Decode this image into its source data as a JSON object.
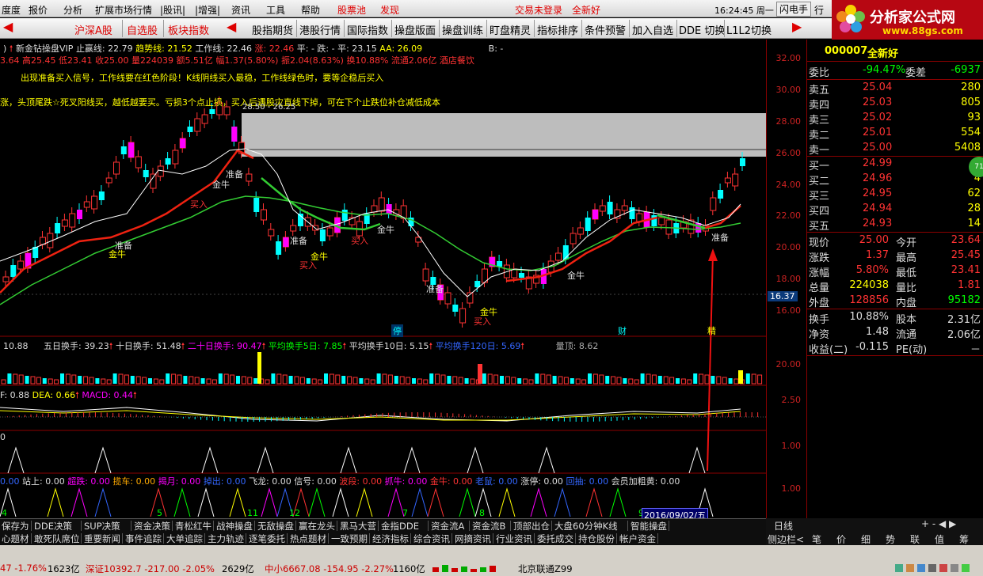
{
  "menubar": {
    "items": [
      "度度",
      "报价",
      "分析",
      "扩展市场行情",
      "|股讯|",
      "|增强|",
      "资讯",
      "工具",
      "帮助",
      "股票池",
      "发现"
    ],
    "login_status": "交易未登录",
    "stock_name": "全新好",
    "time": "16:24:45 周一",
    "flash_btn": "闪电手",
    "row_btn": "行"
  },
  "toolbar": {
    "items": [
      "沪深A股",
      "自选股",
      "板块指数",
      "股指期货",
      "港股行情",
      "国际指数",
      "操盘版面",
      "操盘训练",
      "盯盘精灵",
      "指标排序",
      "条件预警",
      "加入自选",
      "DDE 切换",
      "L1L2切换"
    ]
  },
  "logo": {
    "title": "分析家公式网",
    "url": "www.88gs.com"
  },
  "main_chart": {
    "title": "新金钻操盘VIP",
    "header_values": [
      "止赢线: 22.79",
      "趋势线: 21.52",
      "工作线: 22.46",
      "涨: 22.46",
      "平: -",
      "跌: -",
      "平: 23.15",
      "AA: 26.09",
      "B: -"
    ],
    "info_line": "3.64 高25.45 低23.41 收25.00 量224039 额5.51亿 幅1.37(5.80%) 振2.04(8.63%) 换10.88% 流通2.06亿 酒店餐饮",
    "note1": "出现准备买入信号，工作线要在红色阶段！K线阴线买入最稳，工作线绿色时，要等企稳后买入",
    "note2": "涨，头顶尾跌☆死叉阳线买，越低越要买。亏损3个点止损，买入后遇股灾直线下掉，可在下个止跌位补仓减低成本",
    "overlay_label": "28.50 - 26.25",
    "yaxis": [
      "32.00",
      "30.00",
      "28.00",
      "26.00",
      "24.00",
      "22.00",
      "20.00",
      "18.00",
      "16.00"
    ],
    "price_tag": "16.37",
    "signals": [
      "准备",
      "金牛",
      "买入",
      "准备",
      "金牛",
      "买入",
      "金牛",
      "买入",
      "准备",
      "金牛",
      "准备",
      "金牛",
      "买入",
      "金牛",
      "准备"
    ],
    "markers": [
      "停",
      "财",
      "精"
    ]
  },
  "turnover": {
    "labels": [
      "10.88",
      "五日换手: 39.23",
      "十日换手: 51.48",
      "二十日换手: 90.47",
      "平均换手5日: 7.85",
      "平均换手10日: 5.15",
      "平均换手120日: 5.69",
      "量顶: 8.62"
    ],
    "yaxis": [
      "20.00"
    ]
  },
  "macd": {
    "labels": [
      "F: 0.88",
      "DEA: 0.66",
      "MACD: 0.44"
    ],
    "yaxis": [
      "2.50"
    ]
  },
  "ind3": {
    "labels": [
      "0"
    ],
    "yaxis": [
      "1.00"
    ]
  },
  "ind4": {
    "labels": [
      "0.00",
      "站上: 0.00",
      "超跌: 0.00",
      "揽车: 0.00",
      "揭月: 0.00",
      "掉出: 0.00",
      "飞龙: 0.00",
      "信号: 0.00",
      "波段: 0.00",
      "抓牛: 0.00",
      "金牛: 0.00",
      "老鼠: 0.00",
      "涨停: 0.00",
      "回抽: 0.00",
      "会员加粗黄: 0.00"
    ],
    "yaxis": [
      "1.00"
    ]
  },
  "timeline": [
    "4",
    "5",
    "11",
    "12",
    "7",
    "8",
    "9"
  ],
  "date_label": "2016/09/02/五",
  "bottom_tabs1": [
    "保存为",
    "DDE决策",
    "SUP决策",
    "资金决策",
    "青松红牛",
    "战神操盘",
    "无敌操盘",
    "赢在龙头",
    "黑马大营",
    "金指DDE",
    "资金流A",
    "资金流B",
    "顶部出仓",
    "大盘60分钟K线",
    "智能操盘"
  ],
  "bottom_tabs2": [
    "心题材",
    "敢死队席位",
    "重要新闻",
    "事件追踪",
    "大单追踪",
    "主力轨迹",
    "逐笔委托",
    "热点题材",
    "一致预期",
    "经济指标",
    "综合资讯",
    "网摘资讯",
    "行业资讯",
    "委托成交",
    "持仓股份",
    "帐户资金"
  ],
  "right_tabs1": [
    "日线"
  ],
  "right_tabs2": [
    "侧边栏<",
    "笔",
    "价",
    "细",
    "势",
    "联",
    "值",
    "筹"
  ],
  "quote": {
    "code": "000007",
    "name": "全新好",
    "weibi_label": "委比",
    "weibi": "-94.47%",
    "weicha_label": "委差",
    "weicha": "-6937",
    "sells": [
      {
        "l": "卖五",
        "p": "25.04",
        "v": "280"
      },
      {
        "l": "卖四",
        "p": "25.03",
        "v": "805"
      },
      {
        "l": "卖三",
        "p": "25.02",
        "v": "93"
      },
      {
        "l": "卖二",
        "p": "25.01",
        "v": "554"
      },
      {
        "l": "卖一",
        "p": "25.00",
        "v": "5408"
      }
    ],
    "buys": [
      {
        "l": "买一",
        "p": "24.99",
        "v": "6"
      },
      {
        "l": "买二",
        "p": "24.96",
        "v": "4"
      },
      {
        "l": "买三",
        "p": "24.95",
        "v": "62"
      },
      {
        "l": "买四",
        "p": "24.94",
        "v": "28"
      },
      {
        "l": "买五",
        "p": "24.93",
        "v": "14"
      }
    ],
    "stats": [
      {
        "l1": "现价",
        "v1": "25.00",
        "l2": "今开",
        "v2": "23.64"
      },
      {
        "l1": "涨跌",
        "v1": "1.37",
        "l2": "最高",
        "v2": "25.45"
      },
      {
        "l1": "涨幅",
        "v1": "5.80%",
        "l2": "最低",
        "v2": "23.41"
      },
      {
        "l1": "总量",
        "v1": "224038",
        "l2": "量比",
        "v2": "1.81"
      },
      {
        "l1": "外盘",
        "v1": "128856",
        "l2": "内盘",
        "v2": "95182"
      }
    ],
    "stats2": [
      {
        "l1": "换手",
        "v1": "10.88%",
        "l2": "股本",
        "v2": "2.31亿"
      },
      {
        "l1": "净资",
        "v1": "1.48",
        "l2": "流通",
        "v2": "2.06亿"
      },
      {
        "l1": "收益(二)",
        "v1": "-0.115",
        "l2": "PE(动)",
        "v2": "－"
      }
    ],
    "badge": "71"
  },
  "statusbar": {
    "items": [
      "47 -1.76%",
      "1623亿",
      "深证10392.7 -217.00 -2.05%",
      "2629亿",
      "中小6667.08 -154.95 -2.27%",
      "1160亿",
      "北京联通Z99"
    ]
  }
}
